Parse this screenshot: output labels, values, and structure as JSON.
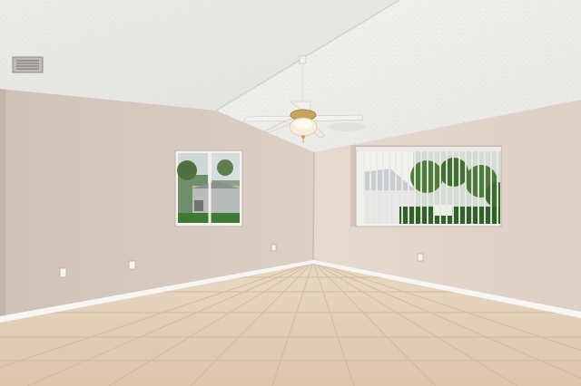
{
  "scene": {
    "kind": "empty room interior",
    "colors": {
      "ceiling": "#eeeeec",
      "ceiling_shadow": "#dcdbd8",
      "wall_left": "#d8cbc1",
      "wall_right": "#e3d6cc",
      "baseboard": "#f7f5f2",
      "floor_tile": "#e2cdb5",
      "grout": "#cdb59c",
      "window_frame": "#f3f1ee",
      "foliage": "#3f7a35",
      "fan_white": "#f4f2ee",
      "fan_brass": "#c9a25c"
    },
    "objects": [
      "ceiling-fan",
      "left-window",
      "right-window-with-blinds",
      "ceiling-vent",
      "wall-outlets",
      "tile-floor"
    ]
  }
}
